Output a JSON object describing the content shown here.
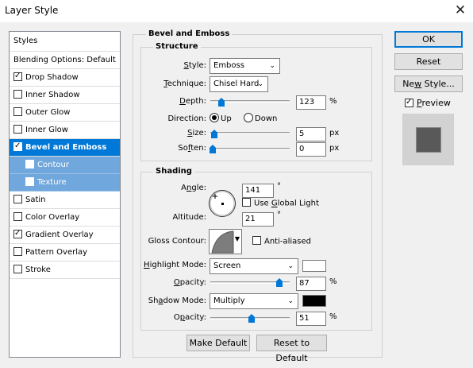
{
  "window": {
    "title": "Layer Style",
    "close_glyph": "✕"
  },
  "left_panel": {
    "header": "Styles",
    "blending_options": "Blending Options: Default",
    "items": [
      {
        "label": "Drop Shadow",
        "checked": true
      },
      {
        "label": "Inner Shadow",
        "checked": false
      },
      {
        "label": "Outer Glow",
        "checked": false
      },
      {
        "label": "Inner Glow",
        "checked": false
      },
      {
        "label": "Bevel and Emboss",
        "checked": true,
        "selected": true
      },
      {
        "label": "Contour",
        "checked": false,
        "sub": true
      },
      {
        "label": "Texture",
        "checked": false,
        "sub": true
      },
      {
        "label": "Satin",
        "checked": false
      },
      {
        "label": "Color Overlay",
        "checked": false
      },
      {
        "label": "Gradient Overlay",
        "checked": true
      },
      {
        "label": "Pattern Overlay",
        "checked": false
      },
      {
        "label": "Stroke",
        "checked": false
      }
    ]
  },
  "bevel": {
    "title": "Bevel and Emboss",
    "structure": {
      "title": "Structure",
      "style_label": "Style:",
      "style_value": "Emboss",
      "technique_label": "Technique:",
      "technique_value": "Chisel Hard",
      "depth_label": "Depth:",
      "depth_value": "123",
      "depth_unit": "%",
      "direction_label": "Direction:",
      "direction_up": "Up",
      "direction_down": "Down",
      "size_label": "Size:",
      "size_value": "5",
      "size_unit": "px",
      "soften_label": "Soften:",
      "soften_value": "0",
      "soften_unit": "px"
    },
    "shading": {
      "title": "Shading",
      "angle_label": "Angle:",
      "angle_value": "141",
      "angle_unit": "°",
      "use_global_light": "Use Global Light",
      "altitude_label": "Altitude:",
      "altitude_value": "21",
      "altitude_unit": "°",
      "gloss_contour_label": "Gloss Contour:",
      "anti_aliased": "Anti-aliased",
      "highlight_mode_label": "Highlight Mode:",
      "highlight_mode_value": "Screen",
      "highlight_color": "#ffffff",
      "highlight_opacity_label": "Opacity:",
      "highlight_opacity_value": "87",
      "shadow_mode_label": "Shadow Mode:",
      "shadow_mode_value": "Multiply",
      "shadow_color": "#000000",
      "shadow_opacity_label": "Opacity:",
      "shadow_opacity_value": "51",
      "opacity_unit": "%"
    },
    "make_default": "Make Default",
    "reset_to_default": "Reset to Default"
  },
  "buttons": {
    "ok": "OK",
    "reset": "Reset",
    "new_style": "New Style...",
    "preview": "Preview"
  },
  "colors": {
    "accent": "#0078d7",
    "sub_selected": "#70a7dc",
    "preview_swatch": "#595959"
  }
}
